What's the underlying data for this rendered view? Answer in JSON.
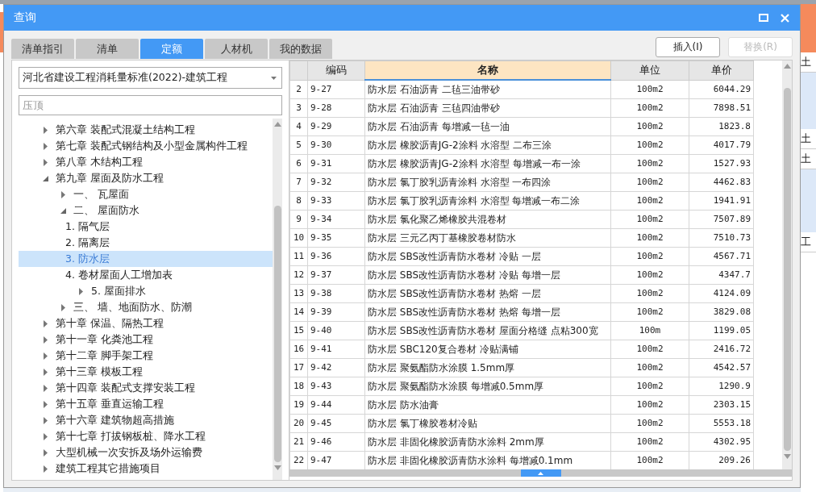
{
  "background": {
    "cells": [
      "土",
      "土",
      "土",
      "工"
    ]
  },
  "window": {
    "title": "查询"
  },
  "tabs": [
    {
      "label": "清单指引",
      "selected": false
    },
    {
      "label": "清单",
      "selected": false
    },
    {
      "label": "定额",
      "selected": true
    },
    {
      "label": "人材机",
      "selected": false
    },
    {
      "label": "我的数据",
      "selected": false
    }
  ],
  "buttons": [
    {
      "label": "插入(I)",
      "disabled": false
    },
    {
      "label": "替换(R)",
      "disabled": true
    }
  ],
  "library": {
    "value": "河北省建设工程消耗量标准(2022)-建筑工程"
  },
  "search": {
    "placeholder": "压顶"
  },
  "tree": [
    {
      "label": "第六章 装配式混凝土结构工程",
      "expanded": false,
      "selected": false
    },
    {
      "label": "第七章 装配式钢结构及小型金属构件工程",
      "expanded": false,
      "selected": false
    },
    {
      "label": "第八章 木结构工程",
      "expanded": false,
      "selected": false
    },
    {
      "label": "第九章 屋面及防水工程",
      "expanded": true,
      "selected": false,
      "children": [
        {
          "label": "一、 瓦屋面",
          "expanded": false,
          "selected": false
        },
        {
          "label": "二、 屋面防水",
          "expanded": true,
          "selected": false,
          "children": [
            {
              "label": "1. 隔气层",
              "selected": false
            },
            {
              "label": "2. 隔离层",
              "selected": false
            },
            {
              "label": "3. 防水层",
              "selected": true
            },
            {
              "label": "4. 卷材屋面人工增加表",
              "selected": false
            },
            {
              "label": "5. 屋面排水",
              "expanded": false,
              "selected": false
            }
          ]
        },
        {
          "label": "三、 墙、地面防水、防潮",
          "expanded": false,
          "selected": false
        }
      ]
    },
    {
      "label": "第十章 保温、隔热工程",
      "expanded": false,
      "selected": false
    },
    {
      "label": "第十一章 化粪池工程",
      "expanded": false,
      "selected": false
    },
    {
      "label": "第十二章 脚手架工程",
      "expanded": false,
      "selected": false
    },
    {
      "label": "第十三章 模板工程",
      "expanded": false,
      "selected": false
    },
    {
      "label": "第十四章 装配式支撑安装工程",
      "expanded": false,
      "selected": false
    },
    {
      "label": "第十五章 垂直运输工程",
      "expanded": false,
      "selected": false
    },
    {
      "label": "第十六章 建筑物超高措施",
      "expanded": false,
      "selected": false
    },
    {
      "label": "第十七章 打拔钢板桩、降水工程",
      "expanded": false,
      "selected": false
    },
    {
      "label": "大型机械一次安拆及场外运输费",
      "expanded": false,
      "selected": false
    },
    {
      "label": "建筑工程其它措施项目",
      "expanded": false,
      "selected": false
    }
  ],
  "table": {
    "columns": [
      {
        "selected": false
      },
      {
        "label": "编码",
        "selected": false
      },
      {
        "label": "名称",
        "selected": true
      },
      {
        "label": "单位",
        "selected": false
      },
      {
        "label": "单价",
        "selected": false
      }
    ],
    "rows": [
      [
        "2",
        "9-27",
        "防水层 石油沥青 二毡三油带砂",
        "100m2",
        "6044.29"
      ],
      [
        "3",
        "9-28",
        "防水层 石油沥青 三毡四油带砂",
        "100m2",
        "7898.51"
      ],
      [
        "4",
        "9-29",
        "防水层 石油沥青 每增减一毡一油",
        "100m2",
        "1823.8"
      ],
      [
        "5",
        "9-30",
        "防水层 橡胶沥青JG-2涂料 水溶型 二布三涂",
        "100m2",
        "4017.79"
      ],
      [
        "6",
        "9-31",
        "防水层 橡胶沥青JG-2涂料 水溶型 每增减一布一涂",
        "100m2",
        "1527.93"
      ],
      [
        "7",
        "9-32",
        "防水层 氯丁胶乳沥青涂料 水溶型 一布四涂",
        "100m2",
        "4462.83"
      ],
      [
        "8",
        "9-33",
        "防水层 氯丁胶乳沥青涂料 水溶型 每增减一布二涂",
        "100m2",
        "1941.91"
      ],
      [
        "9",
        "9-34",
        "防水层 氯化聚乙烯橡胶共混卷材",
        "100m2",
        "7507.89"
      ],
      [
        "10",
        "9-35",
        "防水层 三元乙丙丁基橡胶卷材防水",
        "100m2",
        "7510.73"
      ],
      [
        "11",
        "9-36",
        "防水层 SBS改性沥青防水卷材 冷贴 一层",
        "100m2",
        "4567.71"
      ],
      [
        "12",
        "9-37",
        "防水层 SBS改性沥青防水卷材 冷贴 每增一层",
        "100m2",
        "4347.7"
      ],
      [
        "13",
        "9-38",
        "防水层 SBS改性沥青防水卷材 热熔 一层",
        "100m2",
        "4124.09"
      ],
      [
        "14",
        "9-39",
        "防水层 SBS改性沥青防水卷材 热熔 每增一层",
        "100m2",
        "3829.08"
      ],
      [
        "15",
        "9-40",
        "防水层 SBS改性沥青防水卷材 屋面分格缝 点粘300宽",
        "100m",
        "1199.05"
      ],
      [
        "16",
        "9-41",
        "防水层 SBC120复合卷材 冷贴满铺",
        "100m2",
        "2416.72"
      ],
      [
        "17",
        "9-42",
        "防水层 聚氨酯防水涂膜 1.5mm厚",
        "100m2",
        "4542.57"
      ],
      [
        "18",
        "9-43",
        "防水层 聚氨酯防水涂膜 每增减0.5mm厚",
        "100m2",
        "1290.9"
      ],
      [
        "19",
        "9-44",
        "防水层 防水油膏",
        "100m2",
        "2303.15"
      ],
      [
        "20",
        "9-45",
        "防水层 氯丁橡胶卷材冷贴",
        "100m2",
        "5553.18"
      ],
      [
        "21",
        "9-46",
        "防水层 非固化橡胶沥青防水涂料 2mm厚",
        "100m2",
        "4302.95"
      ],
      [
        "22",
        "9-47",
        "防水层 非固化橡胶沥青防水涂料 每增减0.1mm",
        "100m2",
        "209.26"
      ]
    ]
  }
}
